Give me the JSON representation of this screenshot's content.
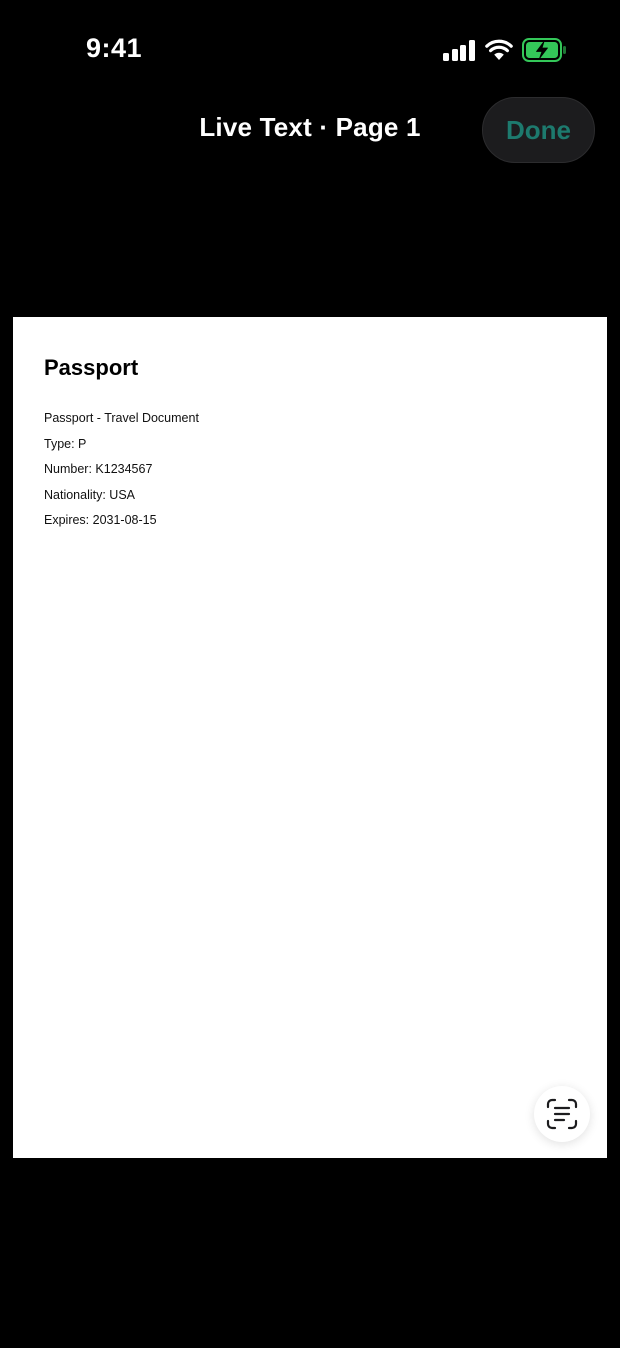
{
  "status_bar": {
    "time": "9:41",
    "icons": [
      "signal-icon",
      "wifi-icon",
      "battery-charging-icon"
    ],
    "battery_color": "#34c759"
  },
  "nav": {
    "title": "Live Text · Page 1",
    "done_label": "Done",
    "done_color": "#1d7a6e"
  },
  "document": {
    "title": "Passport",
    "lines": [
      "Passport - Travel Document",
      "Type: P",
      "Number: K1234567",
      "Nationality: USA",
      "Expires: 2031-08-15"
    ]
  },
  "live_text_button": {
    "icon": "live-text-scan-icon"
  }
}
